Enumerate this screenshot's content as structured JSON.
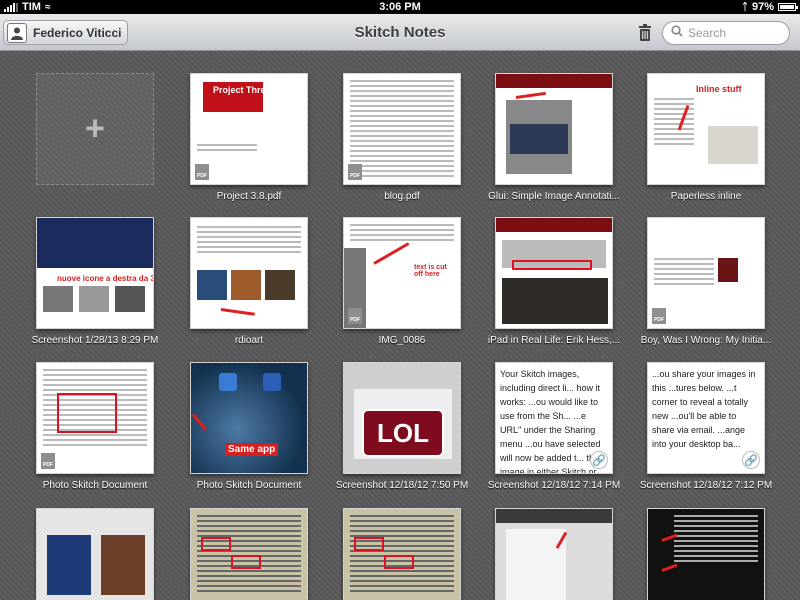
{
  "status_bar": {
    "carrier": "TIM",
    "time": "3:06 PM",
    "battery": "97%",
    "battery_level": 0.97
  },
  "nav": {
    "user_name": "Federico Viticci",
    "title": "Skitch Notes",
    "search_placeholder": "Search"
  },
  "notes": [
    {
      "label": "Project 3.8.pdf",
      "thumb_text": "Project Three"
    },
    {
      "label": "blog.pdf"
    },
    {
      "label": "Glui: Simple Image Annotati..."
    },
    {
      "label": "Paperless inline",
      "thumb_text": "Inline stuff"
    },
    {
      "label": "Screenshot 1/28/13 8:29 PM",
      "thumb_text": "nuove icone a destra da 3.3"
    },
    {
      "label": "rdioart"
    },
    {
      "label": "IMG_0086",
      "thumb_text": "text is cut off here"
    },
    {
      "label": "iPad in Real Life: Erik Hess,..."
    },
    {
      "label": "Boy, Was I Wrong: My Initia..."
    },
    {
      "label": "Photo Skitch Document"
    },
    {
      "label": "Photo Skitch Document",
      "thumb_text": "Same app"
    },
    {
      "label": "Screenshot 12/18/12 7:50 PM",
      "thumb_text": "LOL"
    },
    {
      "label": "Screenshot 12/18/12 7:14 PM",
      "thumb_text": "Your Skitch images, including direct li... how it works: ...ou would like to use from the Sh... ...e URL\" under the Sharing menu ...ou have selected will now be added t... the image in either Skitch or Everno... this version, you'll notice that"
    },
    {
      "label": "Screenshot 12/18/12 7:12 PM",
      "thumb_text": "...ou share your images in this ...tures below. ...t corner to reveal a totally new ...ou'll be able to share via email. ...ange into your desktop ba..."
    },
    {
      "label": ""
    },
    {
      "label": ""
    },
    {
      "label": ""
    },
    {
      "label": ""
    },
    {
      "label": ""
    }
  ],
  "icons": {
    "trash": "trash-icon",
    "search": "search-icon",
    "add": "plus-icon",
    "pdf": "pdf-file-icon",
    "link": "link-icon"
  },
  "colors": {
    "accent_red": "#c0111a",
    "background": "#5c5c5c"
  }
}
